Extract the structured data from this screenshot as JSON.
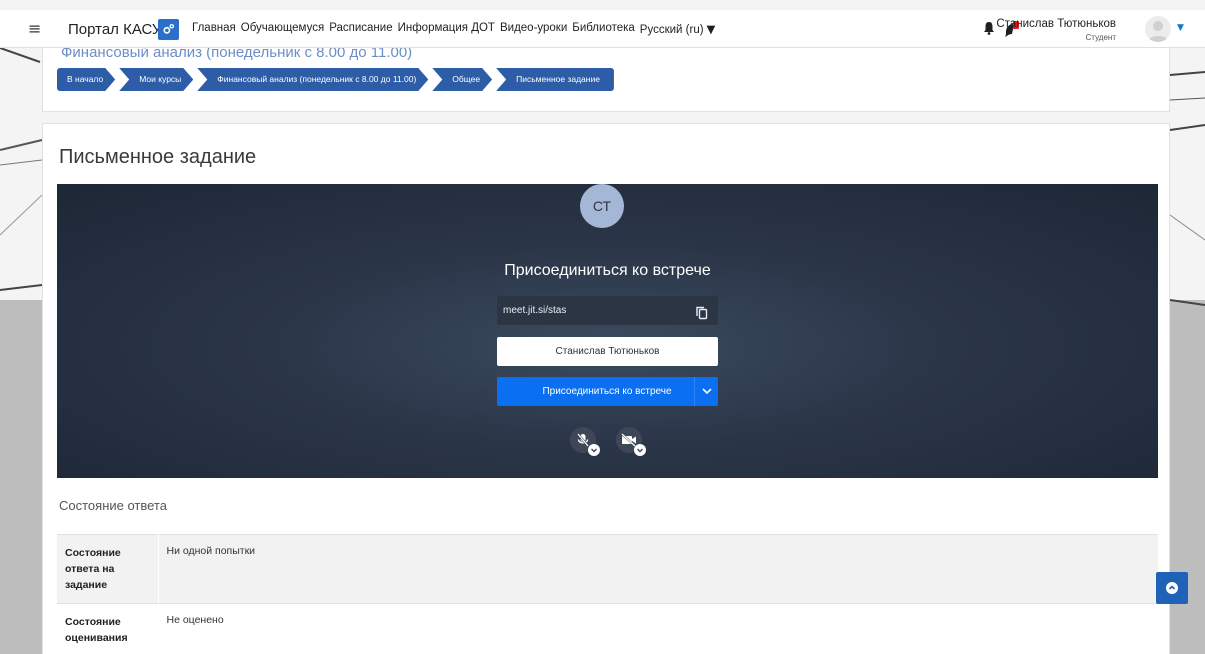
{
  "navbar": {
    "brand": "Портал КАСУ",
    "links": [
      "Главная",
      "Обучающемуся",
      "Расписание",
      "Информация ДОТ",
      "Видео-уроки",
      "Библиотека",
      "Русский (ru)"
    ],
    "user_name": "Станислав Тютюньков",
    "user_role": "Студент",
    "icons": [
      "menu-icon",
      "cog-icon",
      "bell-icon",
      "message-icon",
      "avatar-icon",
      "chevron-down-icon"
    ]
  },
  "header": {
    "course_title": "Финансовый анализ (понедельник с 8.00 до 11.00)",
    "breadcrumb": [
      "В начало",
      "Мои курсы",
      "Финансовый анализ (понедельник с 8.00 до 11.00)",
      "Общее",
      "Письменное задание"
    ]
  },
  "main": {
    "heading": "Письменное задание",
    "jitsi": {
      "initials": "СТ",
      "title": "Присоединиться ко встрече",
      "meeting_url": "meet.jit.si/stas",
      "name_value": "Станислав Тютюньков",
      "join_label": "Присоединиться ко встрече"
    },
    "status_heading": "Состояние ответа",
    "status_rows": [
      {
        "label": "Состояние ответа на задание",
        "value": "Ни одной попытки"
      },
      {
        "label": "Состояние оценивания",
        "value": "Не оценено"
      }
    ]
  },
  "colors": {
    "accent": "#2e5da8",
    "join_button": "#0b6ff1",
    "jitsi_bg": "#2a3547"
  }
}
